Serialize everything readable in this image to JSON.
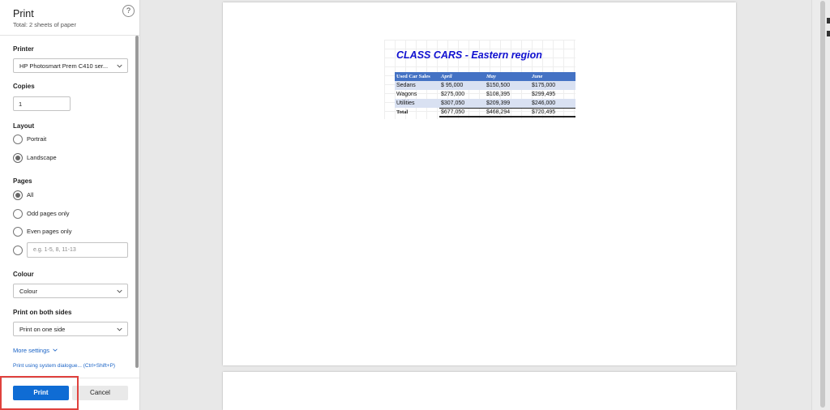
{
  "panel": {
    "title": "Print",
    "subtitle": "Total: 2 sheets of paper",
    "help_glyph": "?",
    "printer": {
      "label": "Printer",
      "value": "HP Photosmart Prem C410 ser..."
    },
    "copies": {
      "label": "Copies",
      "value": "1"
    },
    "layout": {
      "label": "Layout",
      "options": [
        {
          "label": "Portrait",
          "checked": false
        },
        {
          "label": "Landscape",
          "checked": true
        }
      ]
    },
    "pages": {
      "label": "Pages",
      "options": [
        {
          "label": "All",
          "checked": true
        },
        {
          "label": "Odd pages only",
          "checked": false
        },
        {
          "label": "Even pages only",
          "checked": false
        }
      ],
      "range_placeholder": "e.g. 1-5, 8, 11-13"
    },
    "colour": {
      "label": "Colour",
      "value": "Colour"
    },
    "both_sides": {
      "label": "Print on both sides",
      "value": "Print on one side"
    },
    "more_settings": "More settings",
    "system_dialog": "Print using system dialogue... (Ctrl+Shift+P)",
    "print_button": "Print",
    "cancel_button": "Cancel"
  },
  "preview": {
    "sheet_title": "CLASS CARS - Eastern region",
    "table": {
      "headers": [
        "Used Car Sales",
        "April",
        "May",
        "June"
      ],
      "rows": [
        [
          "Sedans",
          "$ 95,000",
          "$150,500",
          "$175,000"
        ],
        [
          "Wagons",
          "$275,000",
          "$108,395",
          "$299,495"
        ],
        [
          "Utilities",
          "$307,050",
          "$209,399",
          "$246,000"
        ]
      ],
      "total": [
        "Total",
        "$677,050",
        "$468,294",
        "$720,495"
      ]
    }
  },
  "colors": {
    "accent": "#0f6cd4",
    "highlight_border": "#e0413d",
    "table_header": "#4472c4",
    "table_band": "#d9e1f2",
    "sheet_title": "#1010d0"
  },
  "icons": {
    "help": "help-icon",
    "dropdown": "chevron-down-icon"
  }
}
